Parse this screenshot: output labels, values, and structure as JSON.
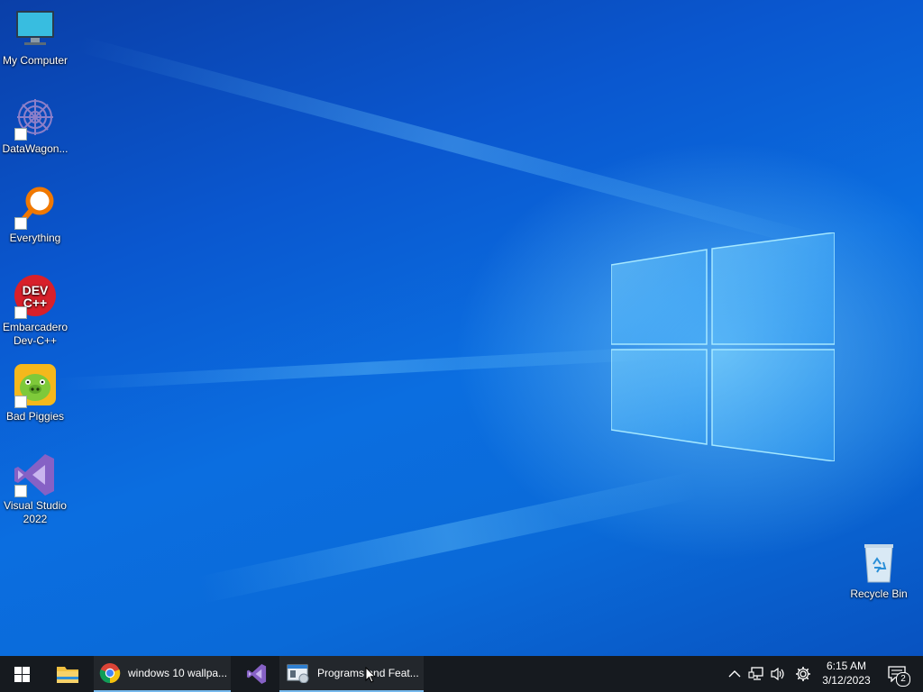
{
  "desktop": {
    "icons": [
      {
        "name": "my-computer",
        "label": "My Computer"
      },
      {
        "name": "datawagon",
        "label": "DataWagon..."
      },
      {
        "name": "everything",
        "label": "Everything"
      },
      {
        "name": "dev-cpp",
        "label": "Embarcadero Dev-C++",
        "icon_text_1": "DEV",
        "icon_text_2": "C++"
      },
      {
        "name": "bad-piggies",
        "label": "Bad Piggies"
      },
      {
        "name": "visual-studio",
        "label": "Visual Studio 2022"
      },
      {
        "name": "recycle-bin",
        "label": "Recycle Bin"
      }
    ],
    "wallpaper_color": "#0b6ee0"
  },
  "taskbar": {
    "start_icon": "windows-logo-icon",
    "pinned": [
      {
        "name": "file-explorer",
        "icon": "folder-icon"
      },
      {
        "name": "chrome",
        "icon": "chrome-icon",
        "label": "windows 10 wallpa..."
      },
      {
        "name": "visual-studio",
        "icon": "visual-studio-icon"
      },
      {
        "name": "programs-and-features",
        "icon": "programs-features-icon",
        "label": "Programs and Feat..."
      }
    ],
    "tray": {
      "time": "6:15 AM",
      "date": "3/12/2023",
      "notification_count": "2",
      "icons": [
        "chevron-up-icon",
        "network-icon",
        "volume-icon",
        "settings-icon",
        "action-center-icon"
      ]
    },
    "accent": "#76b9ed"
  }
}
